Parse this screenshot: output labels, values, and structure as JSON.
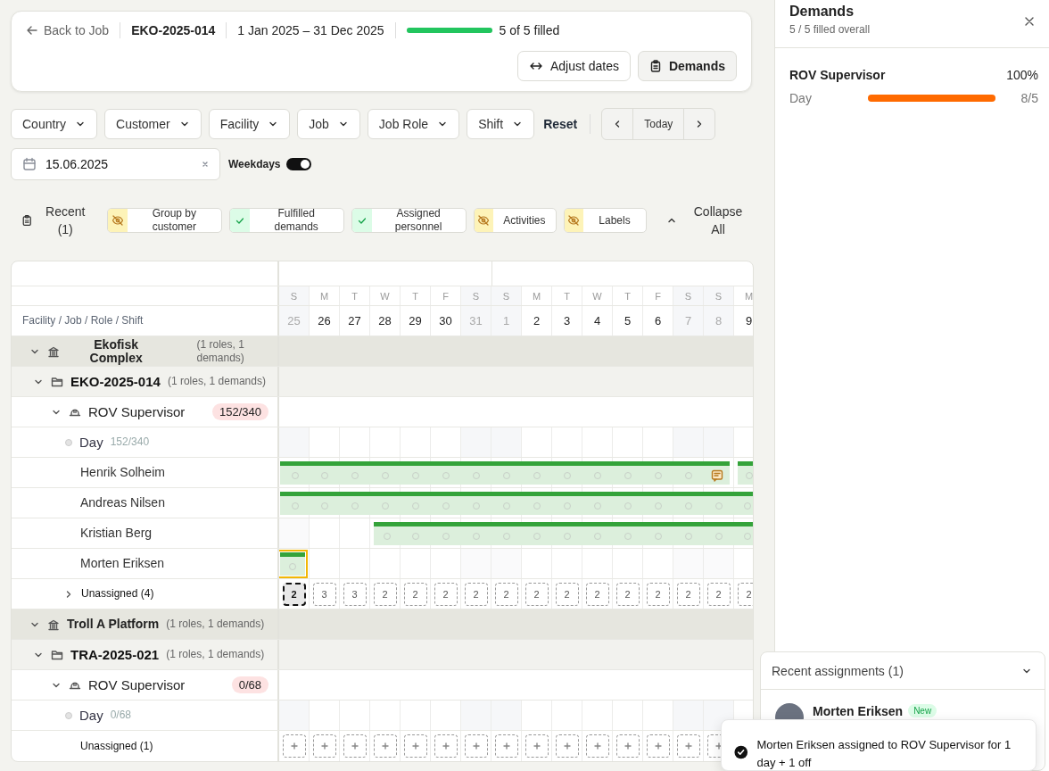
{
  "header": {
    "back_link": "Back to Job",
    "job_code": "EKO-2025-014",
    "date_range": "1 Jan 2025 – 31 Dec 2025",
    "fill": {
      "level": 1
    },
    "fill_label": "5 of 5 filled",
    "buttons": [
      {
        "kind": "adjust",
        "label": "Adjust dates",
        "selected": false
      },
      {
        "kind": "demands",
        "label": "Demands",
        "selected": true
      }
    ]
  },
  "filters": {
    "dropdowns": [
      "Country",
      "Customer",
      "Facility",
      "Job",
      "Job Role",
      "Shift"
    ],
    "reset": "Reset",
    "today": "Today",
    "date": "15.06.2025",
    "weekdays": {
      "label": "Weekdays",
      "on": true
    }
  },
  "toolbar": {
    "recent": "Recent (1)",
    "toggles": [
      {
        "label": "Group by customer",
        "on": false
      },
      {
        "label": "Fulfilled demands",
        "on": true
      },
      {
        "label": "Assigned personnel",
        "on": true
      },
      {
        "label": "Activities",
        "on": false
      },
      {
        "label": "Labels",
        "on": false
      }
    ],
    "collapse": "Collapse All"
  },
  "grid": {
    "column_header": "Facility / Job / Role / Shift",
    "days": [
      {
        "weekday": "S",
        "date": "25",
        "weekend": true
      },
      {
        "weekday": "M",
        "date": "26",
        "weekend": false
      },
      {
        "weekday": "T",
        "date": "27",
        "weekend": false
      },
      {
        "weekday": "W",
        "date": "28",
        "weekend": false
      },
      {
        "weekday": "T",
        "date": "29",
        "weekend": false
      },
      {
        "weekday": "F",
        "date": "30",
        "weekend": false
      },
      {
        "weekday": "S",
        "date": "31",
        "weekend": true
      },
      {
        "weekday": "S",
        "date": "1",
        "weekend": true,
        "month_start": true
      },
      {
        "weekday": "M",
        "date": "2",
        "weekend": false
      },
      {
        "weekday": "T",
        "date": "3",
        "weekend": false
      },
      {
        "weekday": "W",
        "date": "4",
        "weekend": false
      },
      {
        "weekday": "T",
        "date": "5",
        "weekend": false
      },
      {
        "weekday": "F",
        "date": "6",
        "weekend": false
      },
      {
        "weekday": "S",
        "date": "7",
        "weekend": true
      },
      {
        "weekday": "S",
        "date": "8",
        "weekend": true
      },
      {
        "weekday": "M",
        "date": "9",
        "weekend": false
      }
    ],
    "rows": [
      {
        "kind": "facility",
        "name": "Ekofisk Complex",
        "meta": "(1 roles, 1 demands)",
        "expanded": true,
        "children": [
          {
            "kind": "job",
            "name": "EKO-2025-014",
            "meta": "(1 roles, 1 demands)",
            "expanded": true,
            "children": [
              {
                "kind": "role",
                "name": "ROV Supervisor",
                "count": "152/340",
                "expanded": true,
                "children": [
                  {
                    "kind": "shift",
                    "name": "Day",
                    "count": "152/340",
                    "children": [
                      {
                        "kind": "person",
                        "name": "Henrik Solheim",
                        "selected": false,
                        "cells": [
                          {
                            "assigned": true
                          },
                          {
                            "assigned": true
                          },
                          {
                            "assigned": true
                          },
                          {
                            "assigned": true
                          },
                          {
                            "assigned": true
                          },
                          {
                            "assigned": true
                          },
                          {
                            "assigned": true
                          },
                          {
                            "assigned": true
                          },
                          {
                            "assigned": true
                          },
                          {
                            "assigned": true
                          },
                          {
                            "assigned": true
                          },
                          {
                            "assigned": true
                          },
                          {
                            "assigned": true
                          },
                          {
                            "assigned": true
                          },
                          {
                            "assigned": true,
                            "note": true
                          },
                          {
                            "assigned": true,
                            "start": true
                          }
                        ]
                      },
                      {
                        "kind": "person",
                        "name": "Andreas Nilsen",
                        "selected": false,
                        "cells": [
                          {
                            "assigned": true
                          },
                          {
                            "assigned": true
                          },
                          {
                            "assigned": true
                          },
                          {
                            "assigned": true
                          },
                          {
                            "assigned": true
                          },
                          {
                            "assigned": true
                          },
                          {
                            "assigned": true
                          },
                          {
                            "assigned": true
                          },
                          {
                            "assigned": true
                          },
                          {
                            "assigned": true
                          },
                          {
                            "assigned": true
                          },
                          {
                            "assigned": true
                          },
                          {
                            "assigned": true
                          },
                          {
                            "assigned": true
                          },
                          {
                            "assigned": true
                          },
                          {
                            "assigned": true
                          }
                        ]
                      },
                      {
                        "kind": "person",
                        "name": "Kristian Berg",
                        "selected": false,
                        "cells": [
                          {
                            "assigned": false
                          },
                          {
                            "assigned": false
                          },
                          {
                            "assigned": false
                          },
                          {
                            "assigned": true
                          },
                          {
                            "assigned": true
                          },
                          {
                            "assigned": true
                          },
                          {
                            "assigned": true
                          },
                          {
                            "assigned": true
                          },
                          {
                            "assigned": true
                          },
                          {
                            "assigned": true
                          },
                          {
                            "assigned": true
                          },
                          {
                            "assigned": true
                          },
                          {
                            "assigned": true
                          },
                          {
                            "assigned": true
                          },
                          {
                            "assigned": true
                          },
                          {
                            "assigned": true
                          }
                        ]
                      },
                      {
                        "kind": "person",
                        "name": "Morten Eriksen",
                        "selected": true,
                        "cells": [
                          {
                            "assigned": true
                          },
                          {
                            "assigned": false
                          },
                          {
                            "assigned": false
                          },
                          {
                            "assigned": false
                          },
                          {
                            "assigned": false
                          },
                          {
                            "assigned": false
                          },
                          {
                            "assigned": false
                          },
                          {
                            "assigned": false
                          },
                          {
                            "assigned": false
                          },
                          {
                            "assigned": false
                          },
                          {
                            "assigned": false
                          },
                          {
                            "assigned": false
                          },
                          {
                            "assigned": false
                          },
                          {
                            "assigned": false
                          },
                          {
                            "assigned": false
                          },
                          {
                            "assigned": false
                          }
                        ]
                      },
                      {
                        "kind": "unassigned",
                        "label": "Unassigned (4)",
                        "expanded": false,
                        "cells": [
                          {
                            "count": "2",
                            "selected": true
                          },
                          {
                            "count": "3",
                            "selected": false
                          },
                          {
                            "count": "3",
                            "selected": false
                          },
                          {
                            "count": "2",
                            "selected": false
                          },
                          {
                            "count": "2",
                            "selected": false
                          },
                          {
                            "count": "2",
                            "selected": false
                          },
                          {
                            "count": "2",
                            "selected": false
                          },
                          {
                            "count": "2",
                            "selected": false
                          },
                          {
                            "count": "2",
                            "selected": false
                          },
                          {
                            "count": "2",
                            "selected": false
                          },
                          {
                            "count": "2",
                            "selected": false
                          },
                          {
                            "count": "2",
                            "selected": false
                          },
                          {
                            "count": "2",
                            "selected": false
                          },
                          {
                            "count": "2",
                            "selected": false
                          },
                          {
                            "count": "2",
                            "selected": false
                          },
                          {
                            "count": "2",
                            "selected": false
                          }
                        ]
                      }
                    ]
                  }
                ]
              }
            ]
          }
        ]
      },
      {
        "kind": "facility",
        "name": "Troll A Platform",
        "meta": "(1 roles, 1 demands)",
        "expanded": true,
        "children": [
          {
            "kind": "job",
            "name": "TRA-2025-021",
            "meta": "(1 roles, 1 demands)",
            "expanded": true,
            "children": [
              {
                "kind": "role",
                "name": "ROV Supervisor",
                "count": "0/68",
                "expanded": true,
                "children": [
                  {
                    "kind": "shift",
                    "name": "Day",
                    "count": "0/68",
                    "children": [
                      {
                        "kind": "unassigned",
                        "label": "Unassigned (1)"
                      }
                    ]
                  }
                ]
              }
            ]
          }
        ]
      }
    ]
  },
  "demands_panel": {
    "title": "Demands",
    "subtitle": "5 / 5 filled overall",
    "items": [
      {
        "role": "ROV Supervisor",
        "percent": "100%",
        "shifts": [
          {
            "name": "Day",
            "level": 1,
            "count": "8/5"
          }
        ]
      }
    ]
  },
  "recent_assignments": {
    "title": "Recent assignments (1)",
    "expanded": true,
    "items": [
      {
        "name": "Morten Eriksen",
        "badge": "New"
      }
    ]
  },
  "toast": {
    "message": "Morten Eriksen assigned to ROV Supervisor for 1 day + 1 off"
  }
}
